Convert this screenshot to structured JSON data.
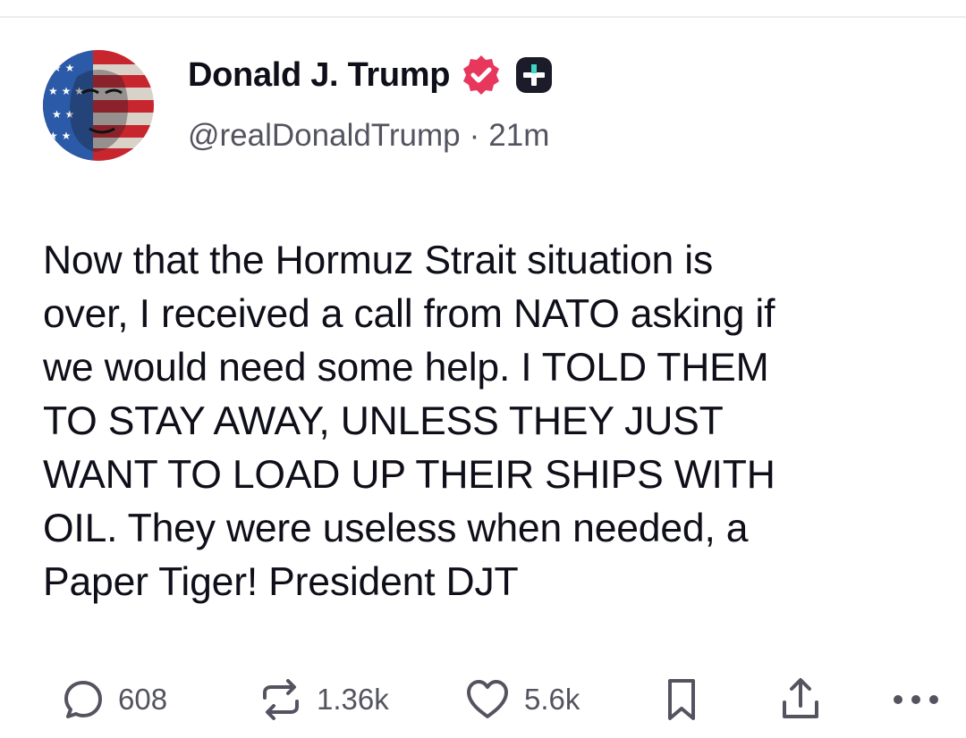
{
  "post": {
    "author": {
      "display_name": "Donald J. Trump",
      "handle": "@realDonaldTrump",
      "time_ago": "21m",
      "separator": "·",
      "verified_icon": "verified-badge-icon",
      "extra_badge_icon": "plus-badge-icon",
      "verified_color": "#e8375d",
      "extra_badge_color": "#1b1b2a"
    },
    "text": "Now that the Hormuz Strait situation is\nover, I received a call from NATO asking if\nwe would need some help. I  TOLD THEM\nTO STAY AWAY, UNLESS THEY JUST\nWANT TO LOAD UP THEIR SHIPS WITH\nOIL. They were useless when needed, a\nPaper Tiger! President DJT",
    "actions": {
      "replies": {
        "icon": "reply-bubble-icon",
        "count": "608"
      },
      "reposts": {
        "icon": "repost-icon",
        "count": "1.36k"
      },
      "likes": {
        "icon": "heart-icon",
        "count": "5.6k"
      },
      "bookmark": {
        "icon": "bookmark-icon"
      },
      "share": {
        "icon": "share-icon"
      },
      "more": {
        "icon": "more-dots-icon"
      }
    }
  },
  "colors": {
    "text": "#0f0f1a",
    "muted": "#545460",
    "divider": "#ececf0"
  }
}
